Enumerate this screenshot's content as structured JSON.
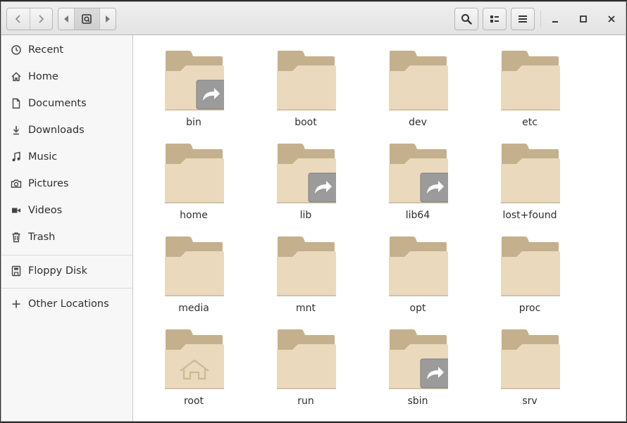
{
  "header": {
    "back_icon": "chevron-left-icon",
    "forward_icon": "chevron-right-icon",
    "search_icon": "search-icon",
    "view_icon": "list-view-icon",
    "menu_icon": "hamburger-menu-icon"
  },
  "sidebar": {
    "items": [
      {
        "label": "Recent",
        "icon": "clock-icon"
      },
      {
        "label": "Home",
        "icon": "home-icon"
      },
      {
        "label": "Documents",
        "icon": "document-icon"
      },
      {
        "label": "Downloads",
        "icon": "download-icon"
      },
      {
        "label": "Music",
        "icon": "music-icon"
      },
      {
        "label": "Pictures",
        "icon": "camera-icon"
      },
      {
        "label": "Videos",
        "icon": "video-icon"
      },
      {
        "label": "Trash",
        "icon": "trash-icon"
      },
      {
        "label": "Floppy Disk",
        "icon": "floppy-disk-icon"
      },
      {
        "label": "Other Locations",
        "icon": "plus-icon"
      }
    ]
  },
  "files": [
    {
      "name": "bin",
      "emblem": "symlink"
    },
    {
      "name": "boot",
      "emblem": ""
    },
    {
      "name": "dev",
      "emblem": ""
    },
    {
      "name": "etc",
      "emblem": ""
    },
    {
      "name": "home",
      "emblem": ""
    },
    {
      "name": "lib",
      "emblem": "symlink"
    },
    {
      "name": "lib64",
      "emblem": "symlink"
    },
    {
      "name": "lost+found",
      "emblem": ""
    },
    {
      "name": "media",
      "emblem": ""
    },
    {
      "name": "mnt",
      "emblem": ""
    },
    {
      "name": "opt",
      "emblem": ""
    },
    {
      "name": "proc",
      "emblem": ""
    },
    {
      "name": "root",
      "emblem": "home"
    },
    {
      "name": "run",
      "emblem": ""
    },
    {
      "name": "sbin",
      "emblem": "symlink"
    },
    {
      "name": "srv",
      "emblem": ""
    }
  ],
  "colors": {
    "folder_back": "#c5b08e",
    "folder_front": "#ead9bd",
    "symlink_emblem": "#9b9b9b"
  }
}
